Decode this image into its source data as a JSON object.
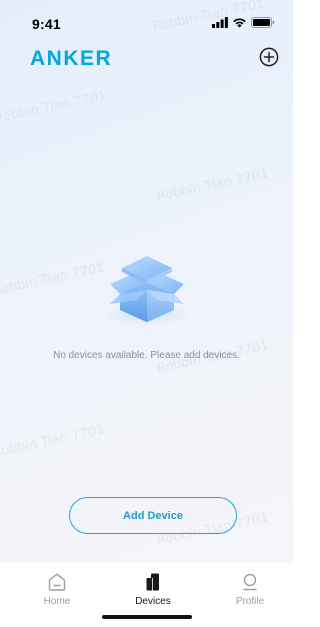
{
  "status_bar": {
    "time": "9:41"
  },
  "header": {
    "logo_text": "ANKER",
    "add_icon": "plus-circle-icon"
  },
  "watermark": {
    "text": "Robbin Tian 7701"
  },
  "empty_state": {
    "icon": "open-box-icon",
    "message": "No devices available. Please add devices."
  },
  "actions": {
    "add_device_label": "Add Device"
  },
  "tab_bar": {
    "tabs": [
      {
        "label": "Home",
        "icon": "home-icon",
        "active": false
      },
      {
        "label": "Devices",
        "icon": "devices-icon",
        "active": true
      },
      {
        "label": "Profile",
        "icon": "profile-icon",
        "active": false
      }
    ]
  },
  "colors": {
    "brand": "#00a7e1",
    "accent": "#1fa6d9"
  }
}
